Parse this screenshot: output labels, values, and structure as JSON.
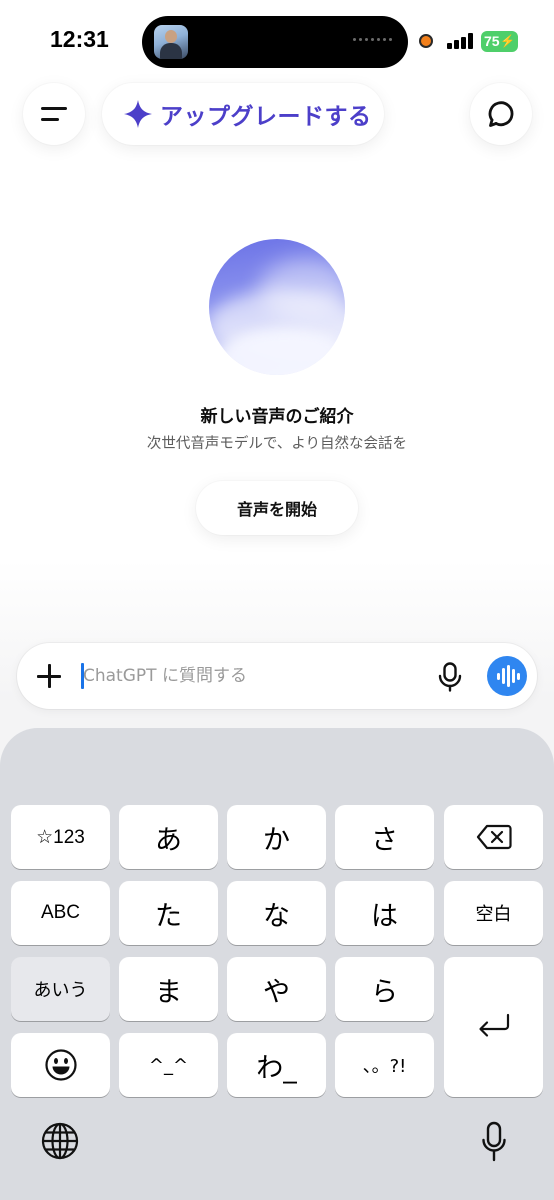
{
  "status_bar": {
    "time": "12:31",
    "battery": "75",
    "recording_color": "#f2801c",
    "battery_color": "#4fcf6a"
  },
  "header": {
    "menu_icon": "menu-icon",
    "upgrade_label": "アップグレードする",
    "upgrade_icon": "sparkle-icon",
    "accent_color": "#4c3fc9",
    "new_chat_icon": "chat-bubble-icon"
  },
  "intro": {
    "title": "新しい音声のご紹介",
    "subtitle": "次世代音声モデルで、より自然な会話を",
    "start_voice_label": "音声を開始"
  },
  "composer": {
    "placeholder": "ChatGPT に質問する",
    "value": "",
    "voice_button_color": "#2f86f0"
  },
  "keyboard": {
    "row1": [
      "☆123",
      "あ",
      "か",
      "さ"
    ],
    "row2": [
      "ABC",
      "た",
      "な",
      "は",
      "空白"
    ],
    "row3": [
      "あいう",
      "ま",
      "や",
      "ら"
    ],
    "row4": [
      "^_^",
      "わ_",
      "、。?!"
    ],
    "delete_icon": "delete-icon",
    "return_icon": "return-icon",
    "emoji_icon": "emoji-icon",
    "globe_icon": "globe-icon",
    "dictation_icon": "microphone-icon"
  }
}
